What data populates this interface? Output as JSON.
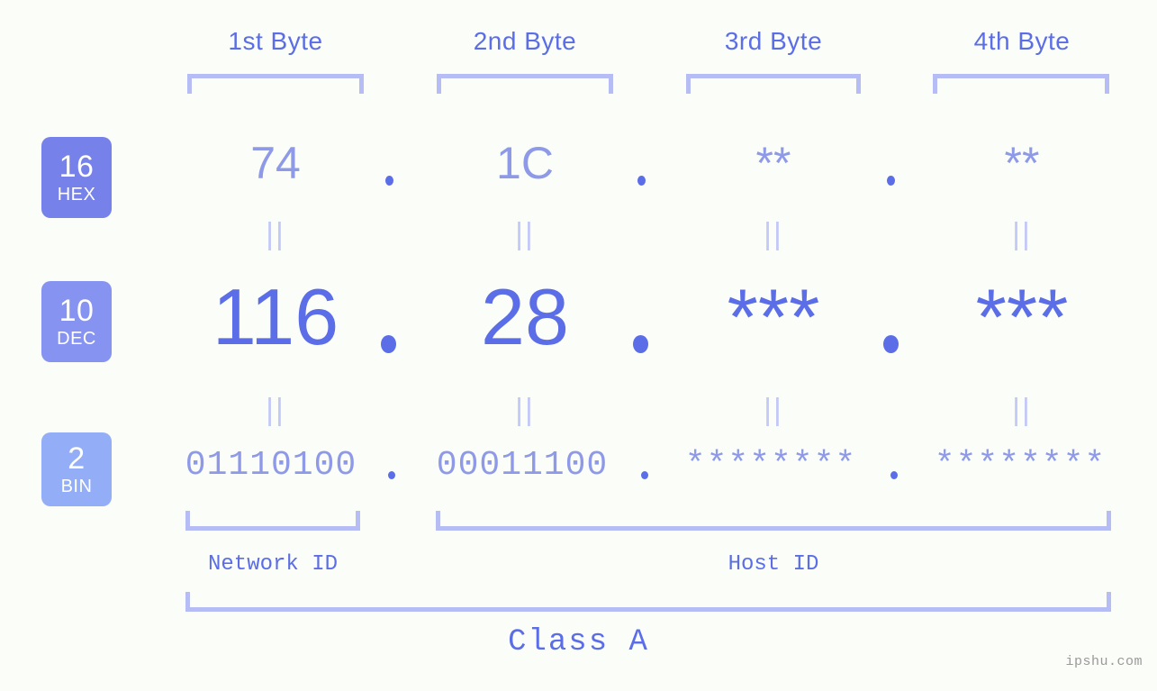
{
  "watermark": "ipshu.com",
  "colors": {
    "background": "#fbfdf8",
    "accent_strong": "#5b6ee8",
    "accent_light": "#8e9ae8",
    "bracket": "#b6bdf5",
    "connector": "#c3c9f7",
    "badge_hex": "#7681ea",
    "badge_dec": "#8793f0",
    "badge_bin": "#93aef7"
  },
  "byte_headers": [
    {
      "label": "1st Byte"
    },
    {
      "label": "2nd Byte"
    },
    {
      "label": "3rd Byte"
    },
    {
      "label": "4th Byte"
    }
  ],
  "bases": [
    {
      "radix": "16",
      "name": "HEX"
    },
    {
      "radix": "10",
      "name": "DEC"
    },
    {
      "radix": "2",
      "name": "BIN"
    }
  ],
  "rows": {
    "hex": {
      "radix": "16",
      "name": "HEX",
      "values": [
        "74",
        "1C",
        "**",
        "**"
      ],
      "separator": "."
    },
    "dec": {
      "radix": "10",
      "name": "DEC",
      "values": [
        "116",
        "28",
        "***",
        "***"
      ],
      "separator": "."
    },
    "bin": {
      "radix": "2",
      "name": "BIN",
      "values": [
        "01110100",
        "00011100",
        "********",
        "********"
      ],
      "separator": "."
    }
  },
  "connectors": {
    "symbol": "||",
    "count_per_row": 4
  },
  "segments": [
    {
      "label": "Network ID"
    },
    {
      "label": "Host ID"
    }
  ],
  "class": {
    "label": "Class A"
  }
}
